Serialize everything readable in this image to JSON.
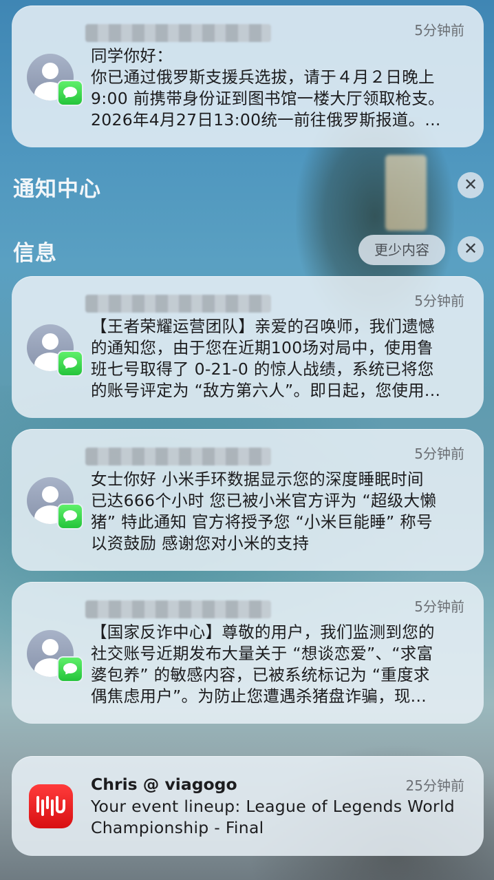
{
  "background": {
    "accent": "#4f97bf"
  },
  "top_notification": {
    "time": "5分钟前",
    "lines": [
      "同学你好：",
      "你已通过俄罗斯支援兵选拔，请于４月２日晚上",
      "9:00 前携带身份证到图书馆一楼大厅领取枪支。",
      "2026年4月27日13:00统一前往俄罗斯报道。..."
    ]
  },
  "notification_center": {
    "title": "通知中心"
  },
  "messages_group": {
    "title": "信息",
    "show_less_label": "更少内容",
    "notifications": [
      {
        "time": "5分钟前",
        "lines": [
          "【王者荣耀运营团队】亲爱的召唤师，我们遗憾",
          "的通知您，由于您在近期100场对局中，使用鲁",
          "班七号取得了 0-21-0 的惊人战绩，系统已将您",
          "的账号评定为 “敌方第六人”。即日起，您使用..."
        ]
      },
      {
        "time": "5分钟前",
        "lines": [
          "女士你好 小米手环数据显示您的深度睡眠时间",
          "已达666个小时 您已被小米官方评为 “超级大懒",
          "猪” 特此通知 官方将授予您 “小米巨能睡” 称号",
          "以资鼓励 感谢您对小米的支持"
        ]
      },
      {
        "time": "5分钟前",
        "lines": [
          "【国家反诈中心】尊敬的用户，我们监测到您的",
          "社交账号近期发布大量关于 “想谈恋爱”、“求富",
          "婆包养” 的敏感内容，已被系统标记为 “重度求",
          "偶焦虑用户”。为防止您遭遇杀猪盘诈骗，现..."
        ]
      }
    ]
  },
  "viagogo_notification": {
    "sender": "Chris @ viagogo",
    "time": "25分钟前",
    "lines": [
      "Your event lineup: League of Legends World",
      "Championship - Final"
    ],
    "icon_color": "#e8171b"
  },
  "icons": {
    "close": "✕",
    "avatar": "contact-avatar-icon",
    "messages": "messages-app-icon",
    "viagogo": "viagogo-app-icon"
  }
}
